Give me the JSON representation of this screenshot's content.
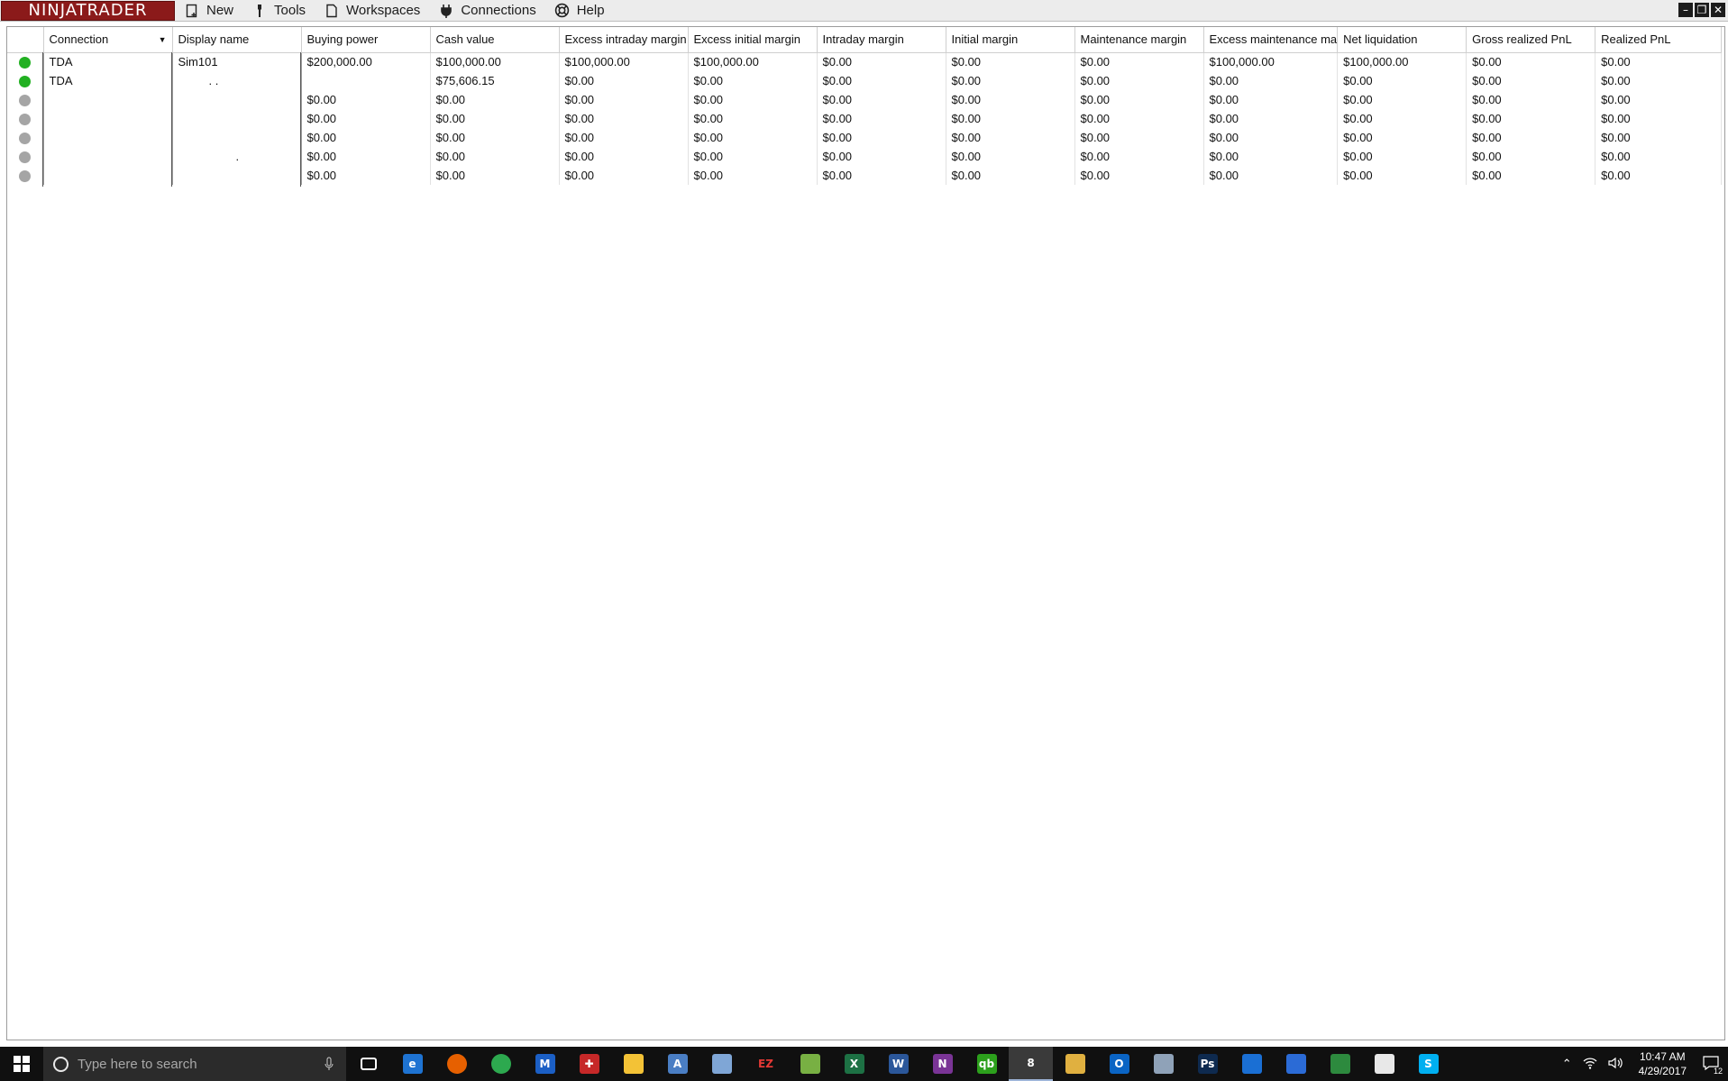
{
  "app": {
    "logo_text": "NINJATRADER"
  },
  "menu": {
    "items": [
      {
        "label": "New",
        "icon": "new-icon"
      },
      {
        "label": "Tools",
        "icon": "tools-icon"
      },
      {
        "label": "Workspaces",
        "icon": "workspaces-icon"
      },
      {
        "label": "Connections",
        "icon": "connections-icon"
      },
      {
        "label": "Help",
        "icon": "help-icon"
      }
    ]
  },
  "window_controls": [
    "minimize-icon",
    "restore-icon",
    "close-icon"
  ],
  "colors": {
    "connected": "#22b022",
    "disconnected": "#a5a5a5",
    "logo_bg": "#8b1a1a"
  },
  "grid": {
    "columns": [
      "",
      "Connection",
      "Display name",
      "Buying power",
      "Cash value",
      "Excess intraday margin",
      "Excess initial margin",
      "Intraday margin",
      "Initial margin",
      "Maintenance margin",
      "Excess maintenance ma",
      "Net liquidation",
      "Gross realized PnL",
      "Realized PnL"
    ],
    "rows": [
      {
        "status": "connected",
        "cells": [
          "TDA",
          "Sim101",
          "$200,000.00",
          "$100,000.00",
          "$100,000.00",
          "$100,000.00",
          "$0.00",
          "$0.00",
          "$0.00",
          "$100,000.00",
          "$100,000.00",
          "$0.00",
          "$0.00"
        ]
      },
      {
        "status": "connected",
        "cells": [
          "TDA",
          ". .",
          "",
          "$75,606.15",
          "$0.00",
          "$0.00",
          "$0.00",
          "$0.00",
          "$0.00",
          "$0.00",
          "$0.00",
          "$0.00",
          "$0.00"
        ]
      },
      {
        "status": "disconnected",
        "cells": [
          "",
          "",
          "$0.00",
          "$0.00",
          "$0.00",
          "$0.00",
          "$0.00",
          "$0.00",
          "$0.00",
          "$0.00",
          "$0.00",
          "$0.00",
          "$0.00"
        ]
      },
      {
        "status": "disconnected",
        "cells": [
          "",
          "",
          "$0.00",
          "$0.00",
          "$0.00",
          "$0.00",
          "$0.00",
          "$0.00",
          "$0.00",
          "$0.00",
          "$0.00",
          "$0.00",
          "$0.00"
        ]
      },
      {
        "status": "disconnected",
        "cells": [
          "",
          "",
          "$0.00",
          "$0.00",
          "$0.00",
          "$0.00",
          "$0.00",
          "$0.00",
          "$0.00",
          "$0.00",
          "$0.00",
          "$0.00",
          "$0.00"
        ]
      },
      {
        "status": "disconnected",
        "cells": [
          "",
          ".",
          "$0.00",
          "$0.00",
          "$0.00",
          "$0.00",
          "$0.00",
          "$0.00",
          "$0.00",
          "$0.00",
          "$0.00",
          "$0.00",
          "$0.00"
        ]
      },
      {
        "status": "disconnected",
        "cells": [
          "",
          "",
          "$0.00",
          "$0.00",
          "$0.00",
          "$0.00",
          "$0.00",
          "$0.00",
          "$0.00",
          "$0.00",
          "$0.00",
          "$0.00",
          "$0.00"
        ]
      }
    ]
  },
  "taskbar": {
    "search_placeholder": "Type here to search",
    "apps": [
      {
        "name": "task-view-icon",
        "color": "#101010",
        "glyph": ""
      },
      {
        "name": "edge-icon",
        "color": "#1e73d2",
        "glyph": "e"
      },
      {
        "name": "firefox-icon",
        "color": "#e66000",
        "glyph": ""
      },
      {
        "name": "chrome-icon",
        "color": "#2da94f",
        "glyph": ""
      },
      {
        "name": "malwarebytes-icon",
        "color": "#1b5fc5",
        "glyph": "M"
      },
      {
        "name": "app-red-icon",
        "color": "#c62828",
        "glyph": "✚"
      },
      {
        "name": "file-explorer-icon",
        "color": "#f3c236",
        "glyph": ""
      },
      {
        "name": "app-doc-icon",
        "color": "#4a7ec4",
        "glyph": "A"
      },
      {
        "name": "app-notes-icon",
        "color": "#7fa6d6",
        "glyph": ""
      },
      {
        "name": "ez-icon",
        "color": "#101010",
        "glyph": "EZ"
      },
      {
        "name": "app-green-chart-icon",
        "color": "#78b043",
        "glyph": ""
      },
      {
        "name": "excel-icon",
        "color": "#1d7144",
        "glyph": "X"
      },
      {
        "name": "word-icon",
        "color": "#2b579a",
        "glyph": "W"
      },
      {
        "name": "onenote-icon",
        "color": "#7a3496",
        "glyph": "N"
      },
      {
        "name": "quickbooks-icon",
        "color": "#2ca01c",
        "glyph": "qb"
      },
      {
        "name": "ninjatrader-icon",
        "color": "#3a3a3a",
        "glyph": "8"
      },
      {
        "name": "app-folder-icon",
        "color": "#e0b040",
        "glyph": ""
      },
      {
        "name": "outlook-icon",
        "color": "#0a64c4",
        "glyph": "O"
      },
      {
        "name": "app-plane-icon",
        "color": "#8fa2b8",
        "glyph": ""
      },
      {
        "name": "photoshop-icon",
        "color": "#0e2a4f",
        "glyph": "Ps"
      },
      {
        "name": "defender-icon",
        "color": "#1a6fd4",
        "glyph": ""
      },
      {
        "name": "app-blue-icon",
        "color": "#2b6bd6",
        "glyph": ""
      },
      {
        "name": "app-game-icon",
        "color": "#2d8a3e",
        "glyph": ""
      },
      {
        "name": "app-film-icon",
        "color": "#e8e8e8",
        "glyph": ""
      },
      {
        "name": "skype-icon",
        "color": "#00aff0",
        "glyph": "S"
      }
    ],
    "clock_time": "10:47 AM",
    "clock_date": "4/29/2017",
    "notification_count": "12"
  }
}
